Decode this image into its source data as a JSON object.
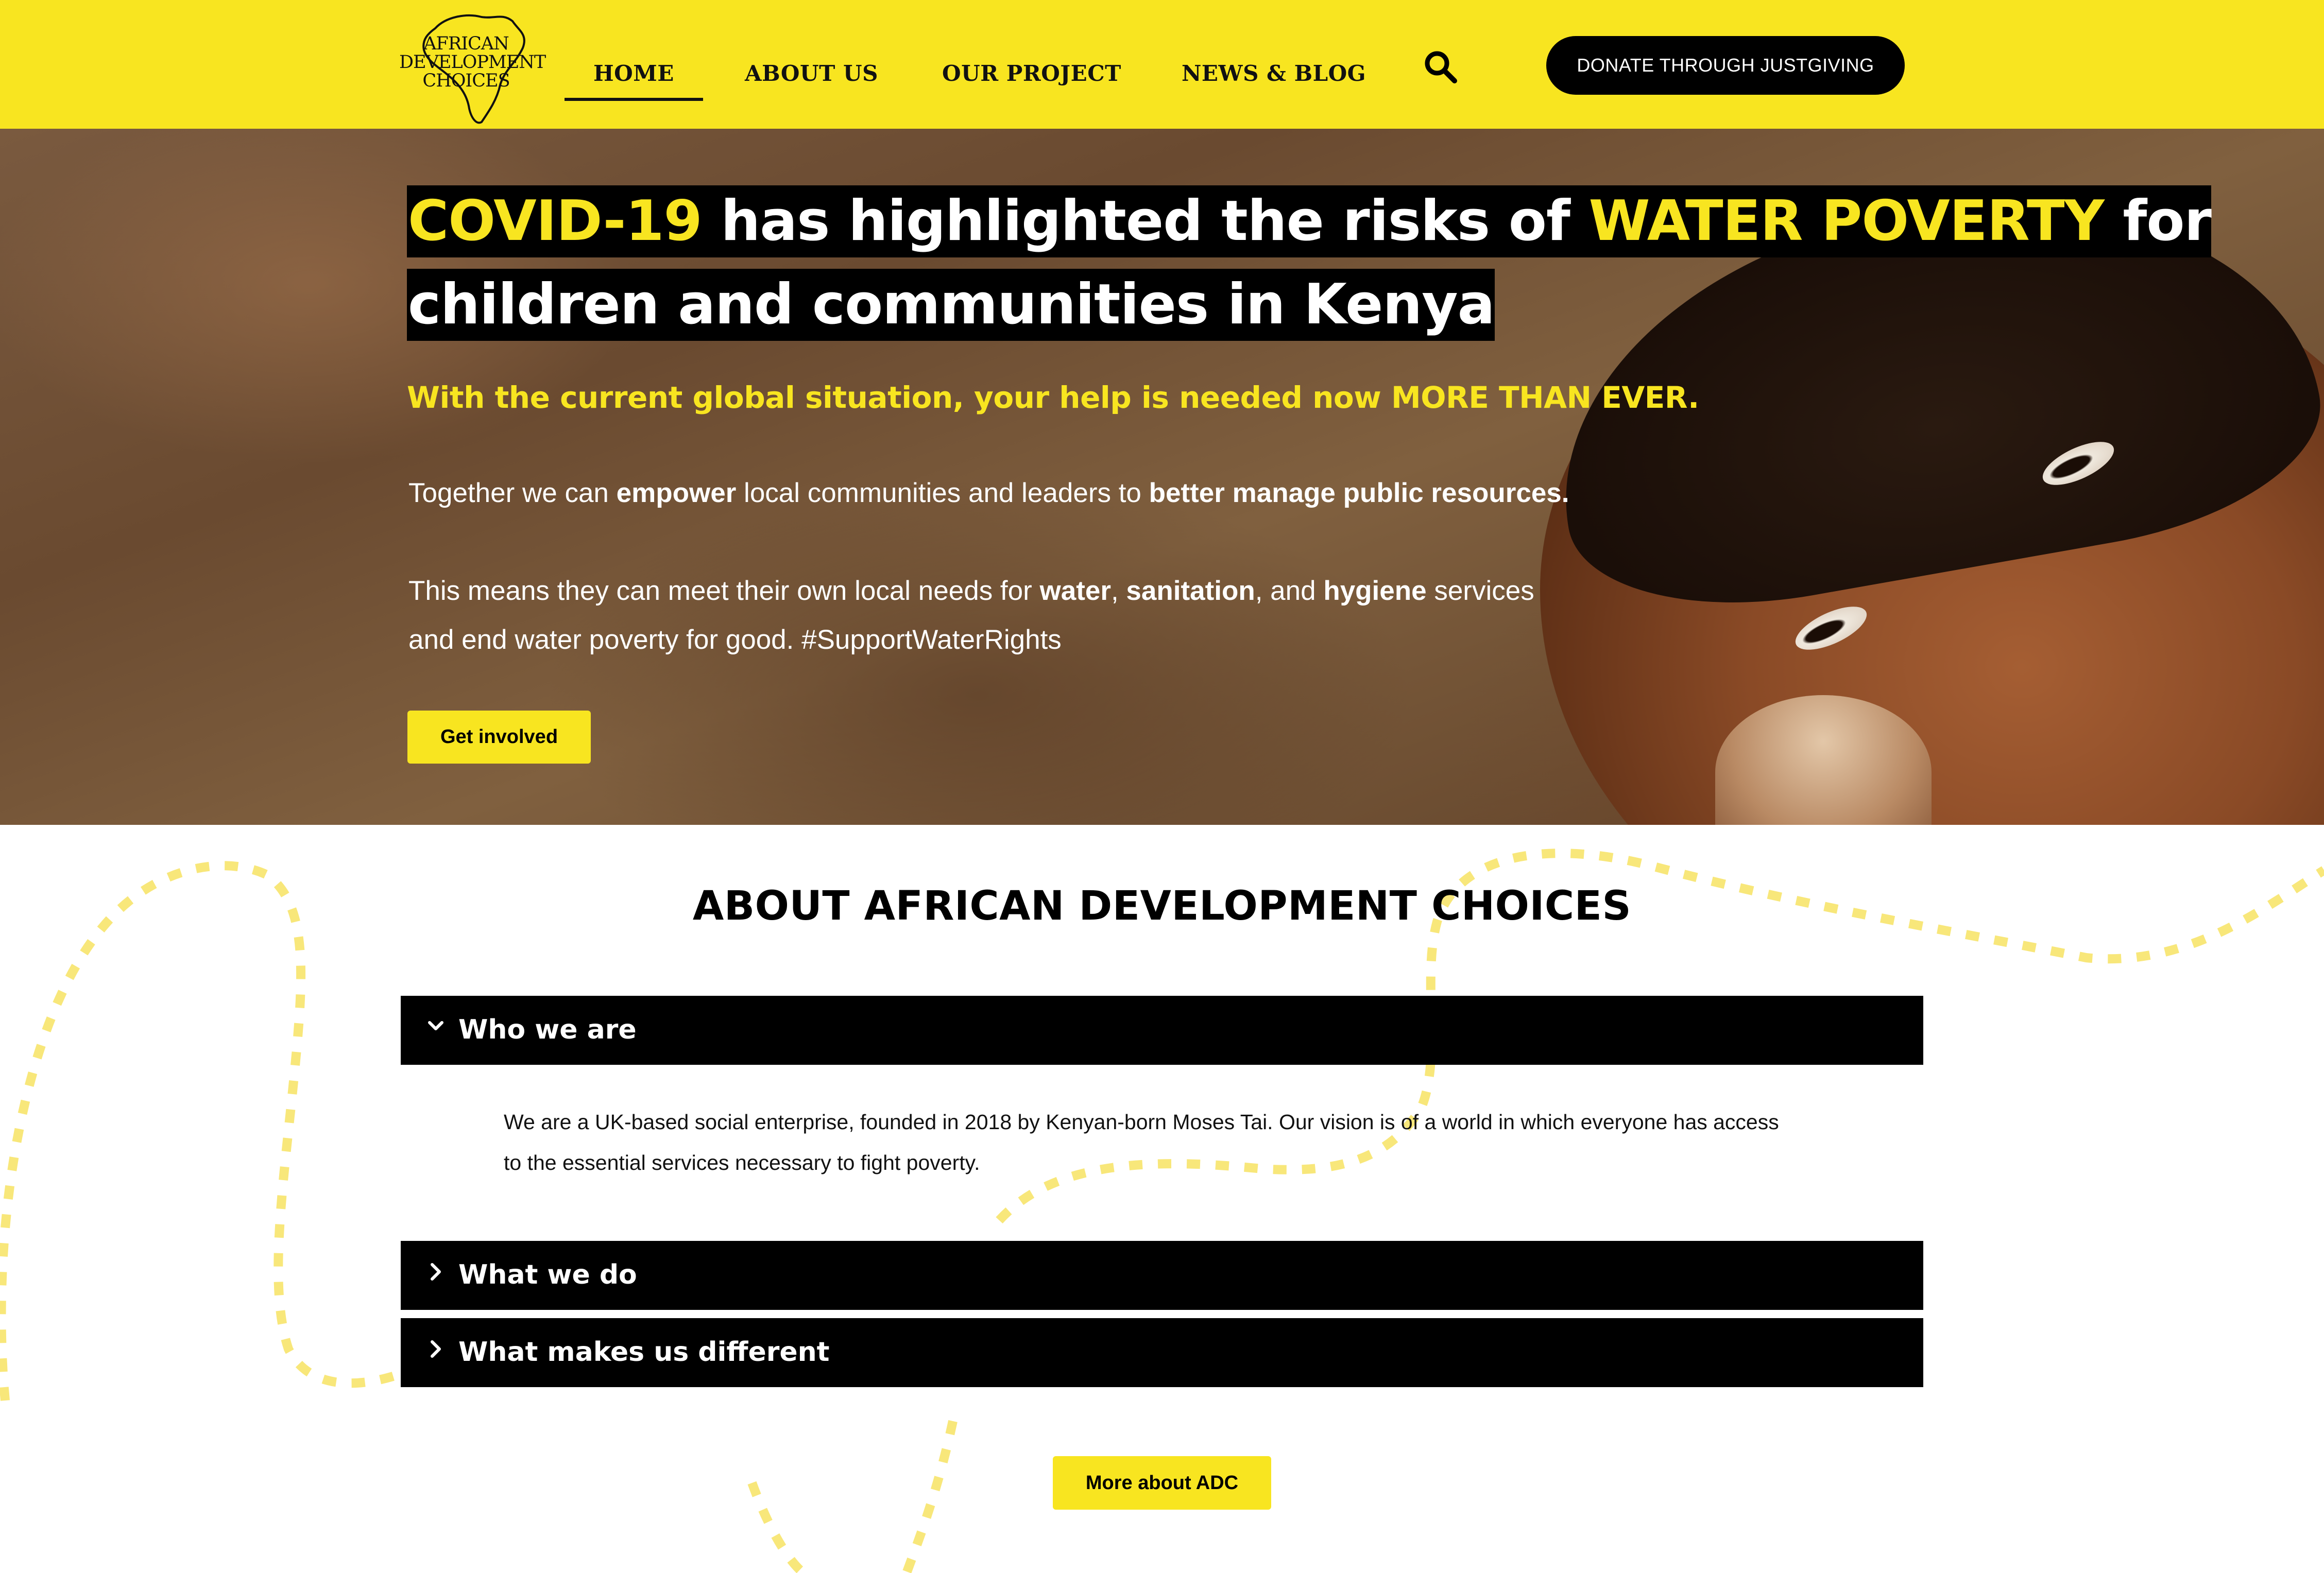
{
  "brand": {
    "logo_lines": [
      "AFRICAN",
      "DEVELOPMENT",
      "CHOICES"
    ],
    "yellow": "#f8e520",
    "black": "#000000"
  },
  "nav": {
    "items": [
      {
        "label": "HOME",
        "active": true
      },
      {
        "label": "ABOUT US",
        "active": false
      },
      {
        "label": "OUR PROJECT",
        "active": false
      },
      {
        "label": "NEWS & BLOG",
        "active": false
      }
    ],
    "search_icon": "search-icon",
    "donate_label": "DONATE THROUGH JUSTGIVING"
  },
  "hero": {
    "title_line1": {
      "hl1": "COVID-19",
      "mid": " has highlighted the risks of ",
      "hl2": "WATER POVERTY",
      "end": " for"
    },
    "title_line2": "children and communities in Kenya",
    "subtitle": "With the current global situation, your help is needed now MORE THAN EVER.",
    "p1": {
      "a": "Together we can ",
      "b": "empower",
      "c": " local communities and leaders to ",
      "d": "better manage public resources."
    },
    "p2_line1": {
      "a": "This means they can meet their own local needs for ",
      "b": "water",
      "c": ", ",
      "d": "sanitation",
      "e": ", and ",
      "f": "hygiene",
      "g": " services"
    },
    "p2_line2": "and end water poverty for good. #SupportWaterRights",
    "cta_label": "Get involved"
  },
  "about": {
    "title": "ABOUT AFRICAN DEVELOPMENT CHOICES",
    "accordion": [
      {
        "label": "Who we are",
        "expanded": true,
        "icon": "chevron-down-icon",
        "body_line1": "We are a UK-based social enterprise, founded in 2018 by Kenyan-born Moses Tai. Our vision is of a world in which everyone has access",
        "body_line2": "to the essential services necessary to fight poverty."
      },
      {
        "label": "What we do",
        "expanded": false,
        "icon": "chevron-right-icon"
      },
      {
        "label": "What makes us different",
        "expanded": false,
        "icon": "chevron-right-icon"
      }
    ],
    "more_label": "More about ADC"
  }
}
